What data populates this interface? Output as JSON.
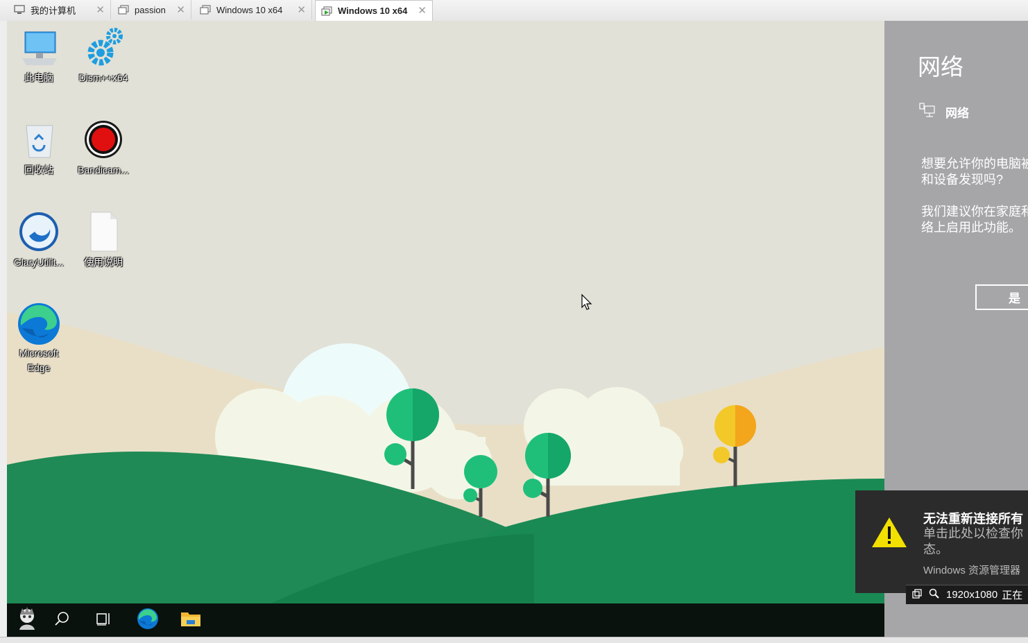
{
  "tabs": [
    {
      "label": "我的计算机",
      "icon": "computer-icon",
      "active": false
    },
    {
      "label": "passion",
      "icon": "vm-window-icon",
      "active": false
    },
    {
      "label": "Windows 10 x64",
      "icon": "vm-window-icon",
      "active": false
    },
    {
      "label": "Windows 10 x64",
      "icon": "vm-running-icon",
      "active": true
    }
  ],
  "desktop_icons": [
    {
      "label": "此电脑",
      "icon": "this-pc-icon"
    },
    {
      "label": "Dism++x64",
      "icon": "gears-icon"
    },
    {
      "label": "回收站",
      "icon": "recycle-bin-icon"
    },
    {
      "label": "Bandicam...",
      "icon": "bandicam-record-icon"
    },
    {
      "label": "GlaryUtilit...",
      "icon": "glary-utilities-icon"
    },
    {
      "label": "使用说明",
      "icon": "text-document-icon"
    },
    {
      "label": "Microsoft Edge",
      "icon": "edge-icon"
    }
  ],
  "taskbar": {
    "items": [
      "start-avatar-icon",
      "search-icon",
      "task-view-icon",
      "edge-icon",
      "file-explorer-icon"
    ]
  },
  "network_panel": {
    "title": "网络",
    "item_label": "网络",
    "question_line1": "想要允许你的电脑被",
    "question_line2": "和设备发现吗?",
    "recommend_line1": "我们建议你在家庭和",
    "recommend_line2": "络上启用此功能。",
    "yes_button": "是"
  },
  "toast": {
    "title": "无法重新连接所有",
    "body_line1": "单击此处以检查你",
    "body_line2": "态。",
    "source": "Windows 资源管理器"
  },
  "status_bar": {
    "resolution": "1920x1080",
    "status": "正在"
  },
  "colors": {
    "taskbar": "#0a120e",
    "panel": "#a6a6a9",
    "hill_dark": "#1f8a55",
    "tree_green": "#1fbf7a",
    "tree_yellow": "#f3b51c",
    "toast_bg": "#2b2b2b",
    "warning_yellow": "#f2e000"
  }
}
